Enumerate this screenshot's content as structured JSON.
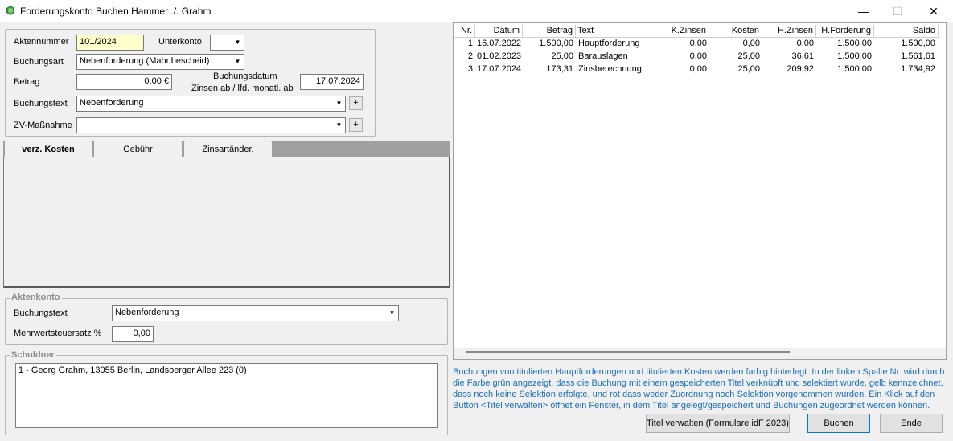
{
  "window": {
    "title": "Forderungskonto Buchen Hammer ./. Grahm",
    "minimize": "—",
    "maximize": "☐",
    "close": "✕"
  },
  "form": {
    "aktennummer_label": "Aktennummer",
    "aktennummer_value": "101/2024",
    "unterkonto_label": "Unterkonto",
    "unterkonto_value": "",
    "buchungsart_label": "Buchungsart",
    "buchungsart_value": "Nebenforderung (Mahnbescheid)",
    "betrag_label": "Betrag",
    "betrag_value": "0,00 €",
    "buchungsdatum_label": "Buchungsdatum",
    "zinsen_label": "Zinsen ab / lfd. monatl. ab",
    "buchungsdatum_value": "17.07.2024",
    "buchungstext_label": "Buchungstext",
    "buchungstext_value": "Nebenforderung",
    "zv_label": "ZV-Maßnahme",
    "zv_value": "",
    "plus": "+"
  },
  "tabs": [
    {
      "label": "verz. Kosten"
    },
    {
      "label": "Gebühr"
    },
    {
      "label": "Zinsartänder."
    }
  ],
  "aktenkonto": {
    "legend": "Aktenkonto",
    "buchungstext_label": "Buchungstext",
    "buchungstext_value": "Nebenforderung",
    "mwst_label": "Mehrwertsteuersatz %",
    "mwst_value": "0,00"
  },
  "schuldner": {
    "legend": "Schuldner",
    "entry": "1 - Georg Grahm, 13055 Berlin, Landsberger Allee 223 (0)"
  },
  "table": {
    "headers": [
      "Nr.",
      "Datum",
      "Betrag",
      "Text",
      "K.Zinsen",
      "Kosten",
      "H.Zinsen",
      "H.Forderung",
      "Saldo"
    ],
    "rows": [
      [
        "1",
        "16.07.2022",
        "1.500,00",
        "Hauptforderung",
        "0,00",
        "0,00",
        "0,00",
        "1.500,00",
        "1.500,00"
      ],
      [
        "2",
        "01.02.2023",
        "25,00",
        "Barauslagen",
        "0,00",
        "25,00",
        "36,61",
        "1.500,00",
        "1.561,61"
      ],
      [
        "3",
        "17.07.2024",
        "173,31",
        "Zinsberechnung",
        "0,00",
        "25,00",
        "209,92",
        "1.500,00",
        "1.734,92"
      ]
    ]
  },
  "info": "Buchungen von titulierten Hauptforderungen und titulierten Kosten werden farbig hinterlegt. In der linken Spalte Nr. wird durch die Farbe grün angezeigt, dass die Buchung mit einem gespeicherten Titel verknüpft und selektiert wurde, gelb kennzeichnet, dass noch keine Selektion erfolgte, und rot dass weder Zuordnung noch Selektion vorgenommen wurden. Ein Klick auf den Button <Titel verwalten> öffnet ein Fenster, in dem Titel angelegt/gespeichert und Buchungen zugeordnet werden können.",
  "buttons": {
    "titel": "Titel verwalten (Formulare idF 2023)",
    "buchen": "Buchen",
    "ende": "Ende"
  },
  "colors": {
    "info_text": "#1a6fb5",
    "field_highlight": "#ffffcc",
    "icon_green": "#2e8b2e"
  }
}
